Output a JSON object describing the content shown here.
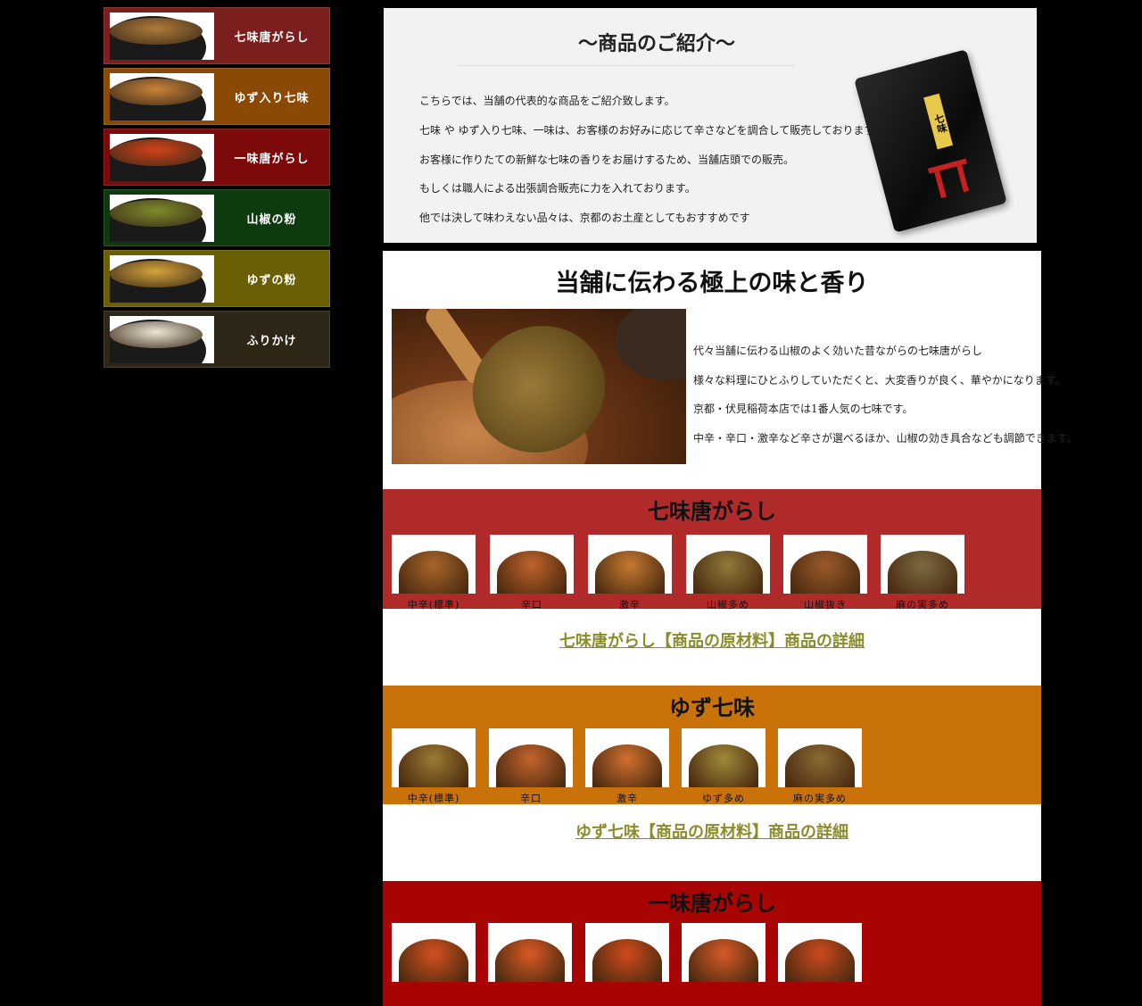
{
  "sidebar": {
    "items": [
      {
        "label": "七味唐がらし",
        "bg": "#7a1e1e",
        "spice": "#b07b3a"
      },
      {
        "label": "ゆず入り七味",
        "bg": "#8a4a06",
        "spice": "#c9823a"
      },
      {
        "label": "一味唐がらし",
        "bg": "#7c0a0a",
        "spice": "#d2421a"
      },
      {
        "label": "山椒の粉",
        "bg": "#0e3a10",
        "spice": "#7e8c2a"
      },
      {
        "label": "ゆずの粉",
        "bg": "#6a5f05",
        "spice": "#d6a43a"
      },
      {
        "label": "ふりかけ",
        "bg": "#2e2718",
        "spice": "#efe6d6"
      }
    ]
  },
  "intro": {
    "title": "～商品のご紹介～",
    "lines": [
      "こちらでは、当舗の代表的な商品をご紹介致します。",
      "七味 や ゆず入り七味、一味は、お客様のお好みに応じて辛さなどを調合して販売しております。",
      "お客様に作りたての新鮮な七味の香りをお届けするため、当舗店頭での販売。",
      "もしくは職人による出張調合販売に力を入れております。",
      "他では決して味わえない品々は、京都のお土産としてもおすすめです"
    ],
    "pack_label": "七味"
  },
  "main": {
    "heading": "当舗に伝わる極上の味と香り",
    "desc": [
      "代々当舗に伝わる山椒のよく効いた昔ながらの七味唐がらし",
      "様々な料理にひとふりしていただくと、大変香りが良く、華やかになります。",
      "京都・伏見稲荷本店では1番人気の七味です。",
      "中辛・辛口・激辛など辛さが選べるほか、山椒の効き具合なども調節できます。"
    ]
  },
  "sections": [
    {
      "title": "七味唐がらし",
      "color": "#b02a2a",
      "items": [
        {
          "name": "中辛(標準)",
          "color": "#a8652a"
        },
        {
          "name": "辛口",
          "color": "#c0622a"
        },
        {
          "name": "激辛",
          "color": "#c77a30"
        },
        {
          "name": "山椒多め",
          "color": "#8d7a3a"
        },
        {
          "name": "山椒抜き",
          "color": "#9a5a2a"
        },
        {
          "name": "麻の実多め",
          "color": "#7a6a40"
        }
      ],
      "link": "七味唐がらし【商品の原材料】商品の詳細"
    },
    {
      "title": "ゆず七味",
      "color": "#c97209",
      "items": [
        {
          "name": "中辛(標準)",
          "color": "#9c7a32"
        },
        {
          "name": "辛口",
          "color": "#c4642c"
        },
        {
          "name": "激辛",
          "color": "#d2702e"
        },
        {
          "name": "ゆず多め",
          "color": "#a08a3a"
        },
        {
          "name": "麻の実多め",
          "color": "#8a6a32"
        }
      ],
      "link": "ゆず七味【商品の原材料】商品の詳細"
    },
    {
      "title": "一味唐がらし",
      "color": "#a80404",
      "items": [
        {
          "name": "",
          "color": "#d4501e"
        },
        {
          "name": "",
          "color": "#d85a24"
        },
        {
          "name": "",
          "color": "#cf4a1c"
        },
        {
          "name": "",
          "color": "#d65a26"
        },
        {
          "name": "",
          "color": "#cc4a1e"
        }
      ]
    }
  ],
  "colors": {
    "link": "#8a8d2a"
  }
}
